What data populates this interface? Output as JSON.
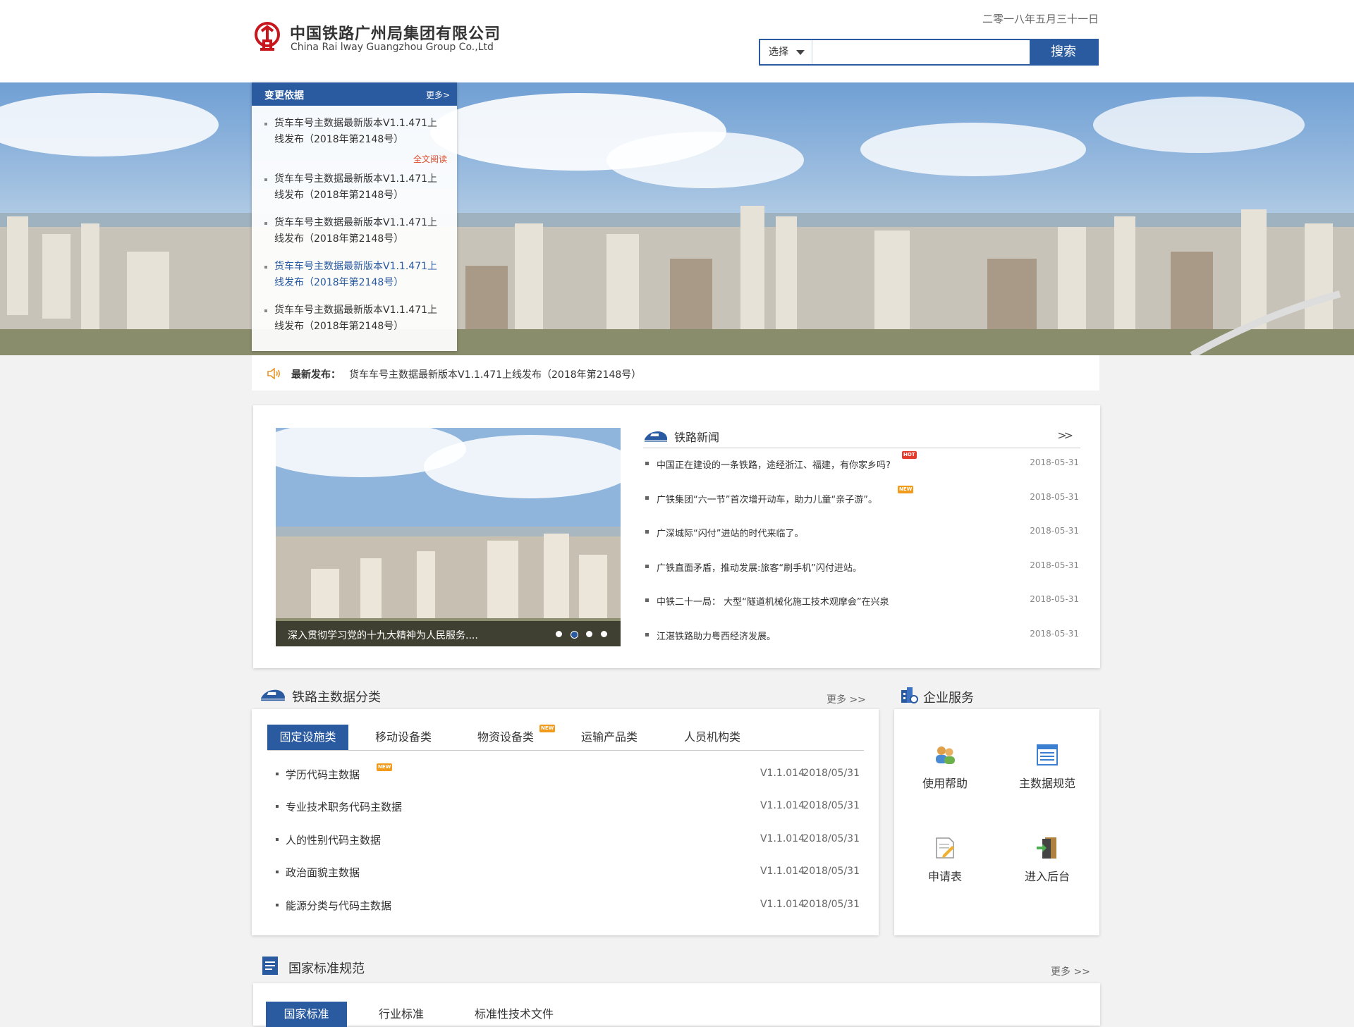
{
  "header": {
    "org_name_cn": "中国铁路广州局集团有限公司",
    "org_name_en": "China Rai lway Guangzhou Group Co.,Ltd",
    "date": "二零一八年五月三十一日"
  },
  "search": {
    "select_label": "选择",
    "placeholder": "",
    "button_label": "搜索"
  },
  "notice": {
    "title": "变更依据",
    "more": "更多>",
    "read_full": "全文阅读",
    "items": [
      {
        "line1": "货车车号主数据最新版本V1.1.471上",
        "line2": "线发布（2018年第2148号）"
      },
      {
        "line1": "货车车号主数据最新版本V1.1.471上",
        "line2": "线发布（2018年第2148号）"
      },
      {
        "line1": "货车车号主数据最新版本V1.1.471上",
        "line2": "线发布（2018年第2148号）"
      },
      {
        "line1": "货车车号主数据最新版本V1.1.471上",
        "line2": "线发布（2018年第2148号）"
      },
      {
        "line1": "货车车号主数据最新版本V1.1.471上",
        "line2": "线发布（2018年第2148号）"
      }
    ]
  },
  "ticker": {
    "label": "最新发布：",
    "text": "货车车号主数据最新版本V1.1.471上线发布（2018年第2148号）"
  },
  "news": {
    "title": "铁路新闻",
    "more": ">>",
    "caption": "深入贯彻学习党的十九大精神为人民服务....",
    "items": [
      {
        "title": "中国正在建设的一条铁路，途经浙江、福建，有你家乡吗?",
        "date": "2018-05-31",
        "badge": "HOT"
      },
      {
        "title": "广铁集团“六一节”首次增开动车，助力儿童“亲子游”。",
        "date": "2018-05-31",
        "badge": "NEW"
      },
      {
        "title": "广深城际“闪付”进站的时代来临了。",
        "date": "2018-05-31"
      },
      {
        "title": "广铁直面矛盾，推动发展:旅客“刷手机”闪付进站。",
        "date": "2018-05-31"
      },
      {
        "title": "中铁二十一局： 大型“隧道机械化施工技术观摩会”在兴泉",
        "date": "2018-05-31"
      },
      {
        "title": "江湛铁路助力粤西经济发展。",
        "date": "2018-05-31"
      }
    ]
  },
  "master_data": {
    "title": "铁路主数据分类",
    "more": "更多 >>",
    "tabs": [
      "固定设施类",
      "移动设备类",
      "物资设备类",
      "运输产品类",
      "人员机构类"
    ],
    "tab_badge": "NEW",
    "rows": [
      {
        "name": "学历代码主数据",
        "version": "V1.1.014",
        "date": "2018/05/31",
        "badge": "NEW"
      },
      {
        "name": "专业技术职务代码主数据",
        "version": "V1.1.014",
        "date": "2018/05/31"
      },
      {
        "name": "人的性别代码主数据",
        "version": "V1.1.014",
        "date": "2018/05/31"
      },
      {
        "name": "政治面貌主数据",
        "version": "V1.1.014",
        "date": "2018/05/31"
      },
      {
        "name": "能源分类与代码主数据",
        "version": "V1.1.014",
        "date": "2018/05/31"
      }
    ]
  },
  "services": {
    "title": "企业服务",
    "items": [
      {
        "label": "使用帮助",
        "icon": "users-help-icon"
      },
      {
        "label": "主数据规范",
        "icon": "document-list-icon"
      },
      {
        "label": "申请表",
        "icon": "form-edit-icon"
      },
      {
        "label": "进入后台",
        "icon": "door-enter-icon"
      }
    ]
  },
  "standards": {
    "title": "国家标准规范",
    "more": "更多 >>",
    "tabs": [
      "国家标准",
      "行业标准",
      "标准性技术文件"
    ]
  },
  "colors": {
    "brand_blue": "#2a5aa0",
    "hot_red": "#e33c2e",
    "new_orange": "#f29a1a",
    "read_red": "#e04b2a"
  }
}
